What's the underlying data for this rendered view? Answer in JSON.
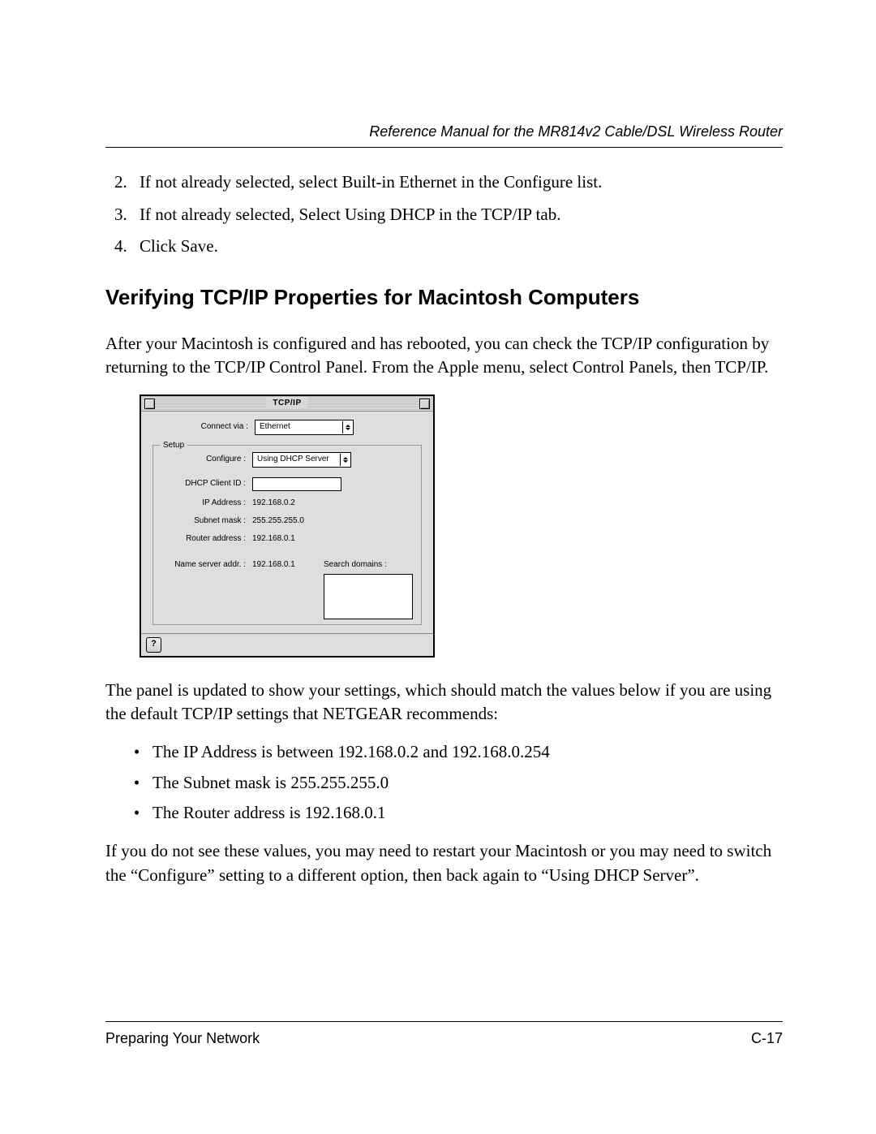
{
  "header": {
    "running_title": "Reference Manual for the MR814v2 Cable/DSL Wireless Router"
  },
  "steps": {
    "item2": "If not already selected, select Built-in Ethernet in the Configure list.",
    "item3": "If not already selected, Select Using DHCP in the TCP/IP tab.",
    "item4": "Click Save."
  },
  "section_title": "Verifying TCP/IP Properties for Macintosh Computers",
  "intro": "After your Macintosh is configured and has rebooted, you can check the TCP/IP configuration by returning to the TCP/IP Control Panel. From the Apple menu, select Control Panels, then TCP/IP.",
  "mac_panel": {
    "title": "TCP/IP",
    "connect_via_label": "Connect via :",
    "connect_via_value": "Ethernet",
    "setup_legend": "Setup",
    "configure_label": "Configure :",
    "configure_value": "Using DHCP Server",
    "dhcp_client_label": "DHCP Client ID :",
    "dhcp_client_value": "",
    "ip_label": "IP Address :",
    "ip_value": "192.168.0.2",
    "subnet_label": "Subnet mask :",
    "subnet_value": "255.255.255.0",
    "router_label": "Router address :",
    "router_value": "192.168.0.1",
    "ns_label": "Name server addr. :",
    "ns_value": "192.168.0.1",
    "search_label": "Search domains :",
    "help_glyph": "?"
  },
  "after_panel": "The panel is updated to show your settings, which should match the values below if you are using the default TCP/IP settings that NETGEAR recommends:",
  "bullets": {
    "b1": "The IP Address is between 192.168.0.2 and 192.168.0.254",
    "b2": "The Subnet mask is 255.255.255.0",
    "b3": "The Router address is 192.168.0.1"
  },
  "closing": "If you do not see these values, you may need to restart your Macintosh or you may need to switch the “Configure” setting to a different option, then back again to “Using DHCP Server”.",
  "footer": {
    "left": "Preparing Your Network",
    "right": "C-17"
  }
}
